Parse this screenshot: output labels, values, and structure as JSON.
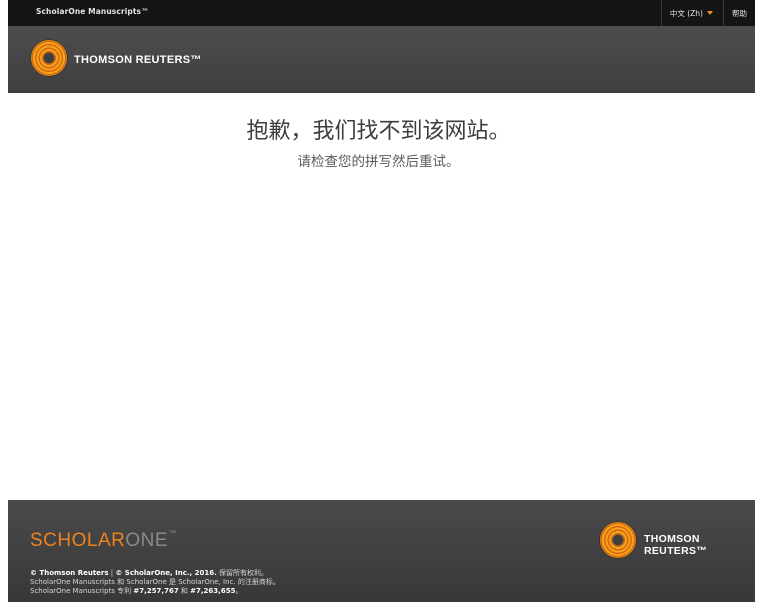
{
  "topbar": {
    "app_title": "ScholarOne Manuscripts™",
    "language_label": "中文 (Zh)",
    "help_label": "帮助"
  },
  "brand": {
    "publisher": "THOMSON REUTERS™"
  },
  "error": {
    "title": "抱歉，我们找不到该网站。",
    "subtitle": "请检查您的拼写然后重试。"
  },
  "footer": {
    "logo_part1": "SCHOLAR",
    "logo_part2": "ONE",
    "logo_tm": "™",
    "publisher": "THOMSON REUTERS™",
    "line1_a": "© Thomson Reuters",
    "line1_sep": " | ",
    "line1_b": "© ScholarOne, Inc., 2016.",
    "line1_c": " 保留所有权利。",
    "line2": "ScholarOne Manuscripts 和 ScholarOne 是 ScholarOne, Inc. 的注册商标。",
    "line3_a": "ScholarOne Manuscripts 专利 ",
    "line3_b": "#7,257,767",
    "line3_c": " 和 ",
    "line3_d": "#7,263,655",
    "line3_e": "。"
  },
  "colors": {
    "accent": "#f0821e",
    "topbar_bg": "#141414",
    "brandbar_bg": "#464646"
  },
  "icons": {
    "caret": "caret-down-icon",
    "logo": "thomson-reuters-dot-sphere-icon"
  }
}
